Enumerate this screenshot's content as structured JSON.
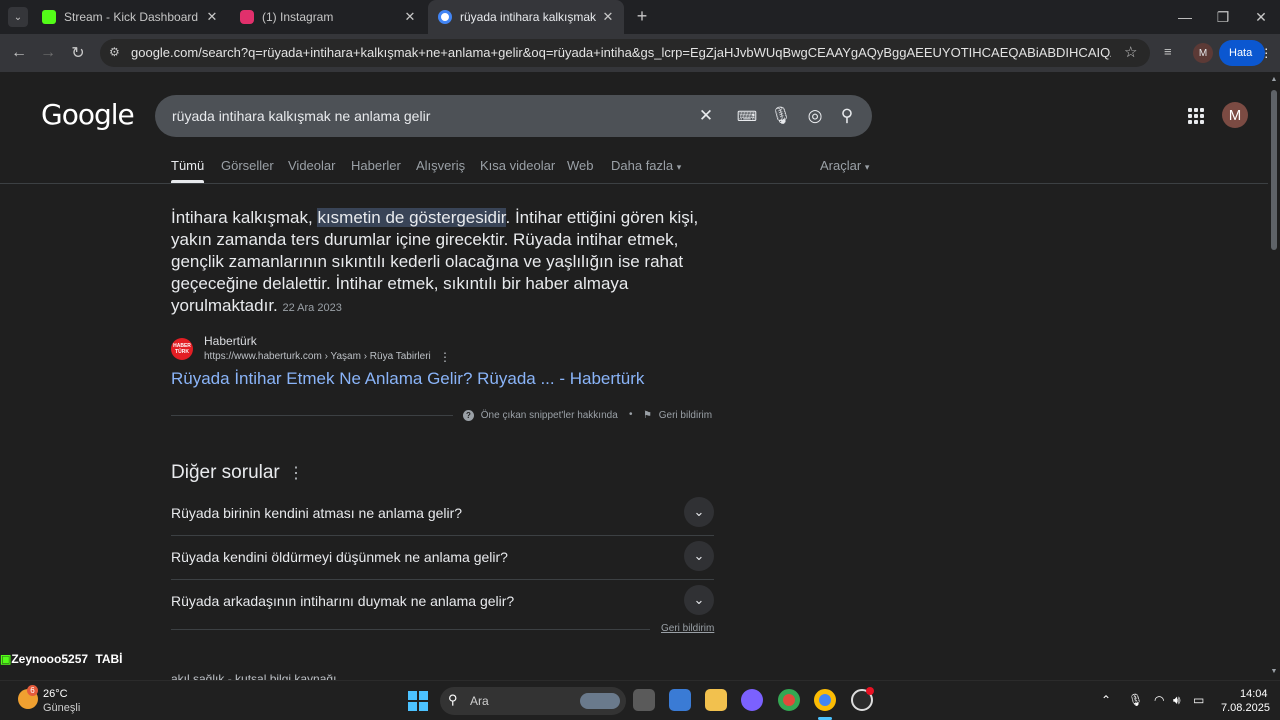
{
  "browser": {
    "tabs": [
      {
        "label": "Stream - Kick Dashboard",
        "favicon": "kick-icon",
        "color": "#53fc18"
      },
      {
        "label": "(1) Instagram",
        "favicon": "instagram-icon",
        "color": "#e1306c"
      },
      {
        "label": "rüyada intihara kalkışmak ne an",
        "favicon": "google-icon",
        "color": "#4285f4"
      }
    ],
    "url": "google.com/search?q=rüyada+intihara+kalkışmak+ne+anlama+gelir&oq=rüyada+intiha&gs_lcrp=EgZjaHJvbWUqBwgCEAAYgAQyBggAEEUYOTIHCAEQABiABDIHCAIQABiABDIHCAMQABiA...",
    "profile_initial": "M",
    "error_label": "Hata"
  },
  "google": {
    "logo": "Google",
    "query": "rüyada intihara kalkışmak ne anlama gelir",
    "avatar_initial": "M",
    "tabs": [
      "Tümü",
      "Görseller",
      "Videolar",
      "Haberler",
      "Alışveriş",
      "Kısa videolar",
      "Web",
      "Daha fazla"
    ],
    "tools_label": "Araçlar"
  },
  "snippet": {
    "text_before": "İntihara kalkışmak, ",
    "highlight": "kısmetin de göstergesidir",
    "text_after": ". İntihar ettiğini gören kişi, yakın zamanda ters durumlar içine girecektir. Rüyada intihar etmek, gençlik zamanlarının sıkıntılı kederli olacağına ve yaşlılığın ise rahat geçeceğine delalettir. İntihar etmek, sıkıntılı bir haber almaya yorulmaktadır.",
    "date": "22 Ara 2023",
    "source_name": "Habertürk",
    "source_favicon_text": "HABER TÜRK",
    "source_url": "https://www.haberturk.com › Yaşam › Rüya Tabirleri",
    "link_title": "Rüyada İntihar Etmek Ne Anlama Gelir? Rüyada ... - Habertürk",
    "about_label": "Öne çıkan snippet'ler hakkında",
    "feedback_label": "Geri bildirim"
  },
  "paa": {
    "title": "Diğer sorular",
    "questions": [
      "Rüyada birinin kendini atması ne anlama gelir?",
      "Rüyada kendini öldürmeyi düşünmek ne anlama gelir?",
      "Rüyada arkadaşının intiharını duymak ne anlama gelir?"
    ],
    "feedback_label": "Geri bildirim",
    "next_result_partial": "akıl sağlık - kutsal bilgi kaynağı"
  },
  "overlay": {
    "username": "Zeynooo5257",
    "badge": "TABİ"
  },
  "taskbar": {
    "weather_temp": "26°C",
    "weather_desc": "Güneşli",
    "weather_badge": "6",
    "search_placeholder": "Ara",
    "time": "14:04",
    "date": "7.08.2025"
  }
}
